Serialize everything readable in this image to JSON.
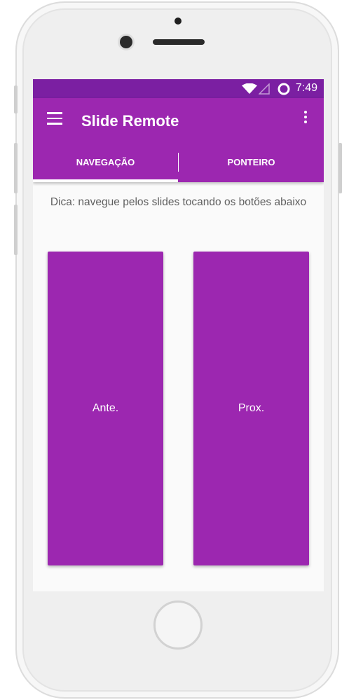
{
  "colors": {
    "primary": "#9c27b0",
    "primary_dark": "#7b1fa2",
    "screen_background": "#fafafa",
    "hint_text": "#5f5f5f"
  },
  "status_bar": {
    "time": "7:49",
    "icons": [
      "wifi-icon",
      "signal-icon",
      "battery-icon"
    ]
  },
  "app_bar": {
    "title": "Slide Remote",
    "menu_icon": "menu-icon",
    "overflow_icon": "more-vert-icon"
  },
  "tabs": [
    {
      "label": "NAVEGAÇÃO",
      "selected": true
    },
    {
      "label": "PONTEIRO",
      "selected": false
    }
  ],
  "main": {
    "hint": "Dica: navegue pelos slides tocando os botões abaixo",
    "prev_label": "Ante.",
    "next_label": "Prox."
  }
}
